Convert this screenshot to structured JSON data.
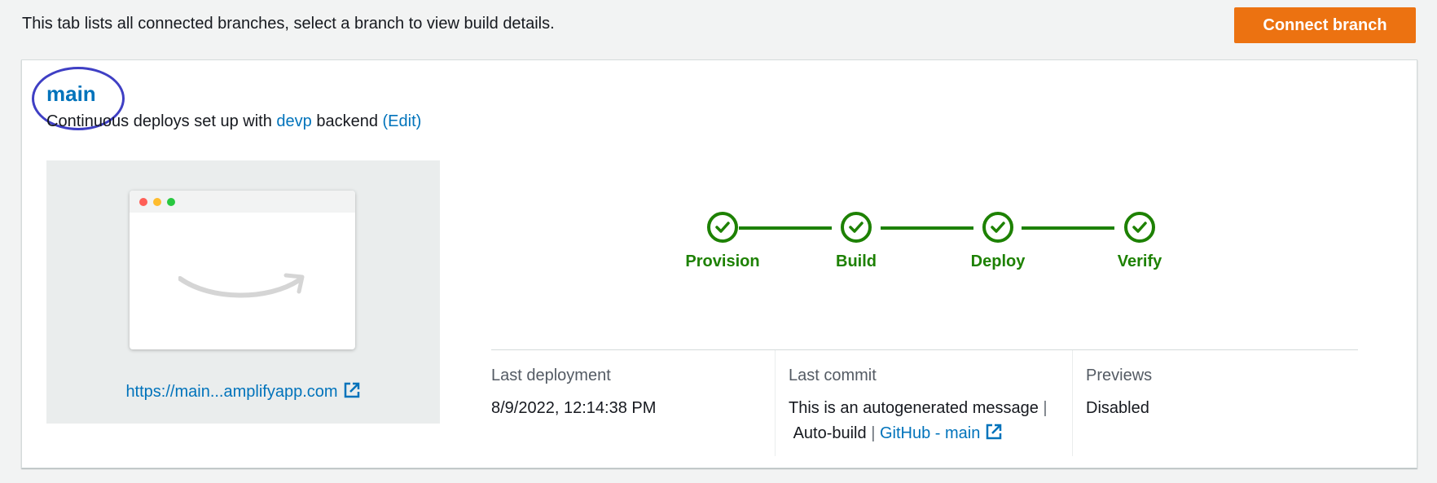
{
  "intro": "This tab lists all connected branches, select a branch to view build details.",
  "connect_button": "Connect branch",
  "branch": {
    "name": "main",
    "desc_prefix": "Continuous deploys set up with ",
    "backend_env": "devp",
    "desc_mid": " backend ",
    "edit_label": "(Edit)"
  },
  "preview": {
    "url": "https://main...amplifyapp.com"
  },
  "steps": [
    {
      "label": "Provision",
      "status": "success"
    },
    {
      "label": "Build",
      "status": "success"
    },
    {
      "label": "Deploy",
      "status": "success"
    },
    {
      "label": "Verify",
      "status": "success"
    }
  ],
  "info": {
    "last_deployment": {
      "label": "Last deployment",
      "value": "8/9/2022, 12:14:38 PM"
    },
    "last_commit": {
      "label": "Last commit",
      "message": "This is an autogenerated message",
      "sep": "|",
      "trigger": "Auto-build",
      "repo_link": "GitHub - main"
    },
    "previews": {
      "label": "Previews",
      "value": "Disabled"
    }
  },
  "colors": {
    "accent": "#ec7211",
    "link": "#0073bb",
    "success": "#1d8102",
    "annotation": "#3f3fc4"
  }
}
